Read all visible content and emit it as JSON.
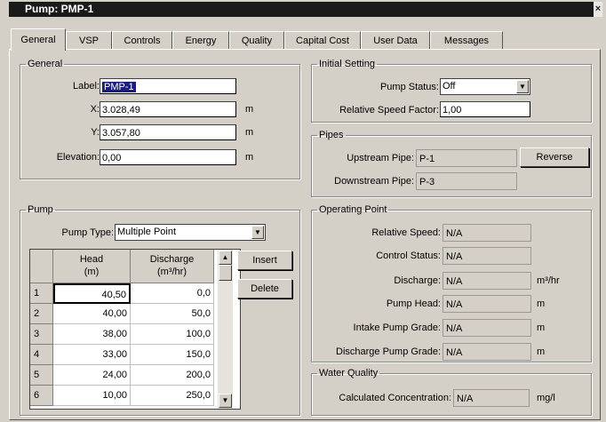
{
  "window": {
    "title": "Pump: PMP-1",
    "close": "×"
  },
  "tabs": [
    "General",
    "VSP",
    "Controls",
    "Energy",
    "Quality",
    "Capital Cost",
    "User Data",
    "Messages"
  ],
  "general": {
    "legend": "General",
    "label_label": "Label:",
    "label_value": "PMP-1",
    "x_label": "X:",
    "x_value": "3.028,49",
    "x_unit": "m",
    "y_label": "Y:",
    "y_value": "3.057,80",
    "y_unit": "m",
    "elev_label": "Elevation:",
    "elev_value": "0,00",
    "elev_unit": "m"
  },
  "initial": {
    "legend": "Initial Setting",
    "status_label": "Pump Status:",
    "status_value": "Off",
    "speed_label": "Relative Speed Factor:",
    "speed_value": "1,00"
  },
  "pipes": {
    "legend": "Pipes",
    "up_label": "Upstream Pipe:",
    "up_value": "P-1",
    "down_label": "Downstream Pipe:",
    "down_value": "P-3",
    "reverse": "Reverse"
  },
  "pump": {
    "legend": "Pump",
    "type_label": "Pump Type:",
    "type_value": "Multiple Point",
    "col_head": "Head",
    "col_head_unit": "(m)",
    "col_dis": "Discharge",
    "col_dis_unit": "(m³/hr)",
    "rows": [
      {
        "n": "1",
        "head": "40,50",
        "dis": "0,0"
      },
      {
        "n": "2",
        "head": "40,00",
        "dis": "50,0"
      },
      {
        "n": "3",
        "head": "38,00",
        "dis": "100,0"
      },
      {
        "n": "4",
        "head": "33,00",
        "dis": "150,0"
      },
      {
        "n": "5",
        "head": "24,00",
        "dis": "200,0"
      },
      {
        "n": "6",
        "head": "10,00",
        "dis": "250,0"
      }
    ],
    "insert": "Insert",
    "delete": "Delete"
  },
  "operating": {
    "legend": "Operating Point",
    "rs_label": "Relative Speed:",
    "rs_value": "N/A",
    "cs_label": "Control Status:",
    "cs_value": "N/A",
    "dis_label": "Discharge:",
    "dis_value": "N/A",
    "dis_unit": "m³/hr",
    "ph_label": "Pump Head:",
    "ph_value": "N/A",
    "ph_unit": "m",
    "ipg_label": "Intake Pump Grade:",
    "ipg_value": "N/A",
    "ipg_unit": "m",
    "dpg_label": "Discharge Pump Grade:",
    "dpg_value": "N/A",
    "dpg_unit": "m"
  },
  "quality": {
    "legend": "Water Quality",
    "cc_label": "Calculated Concentration:",
    "cc_value": "N/A",
    "cc_unit": "mg/l"
  }
}
